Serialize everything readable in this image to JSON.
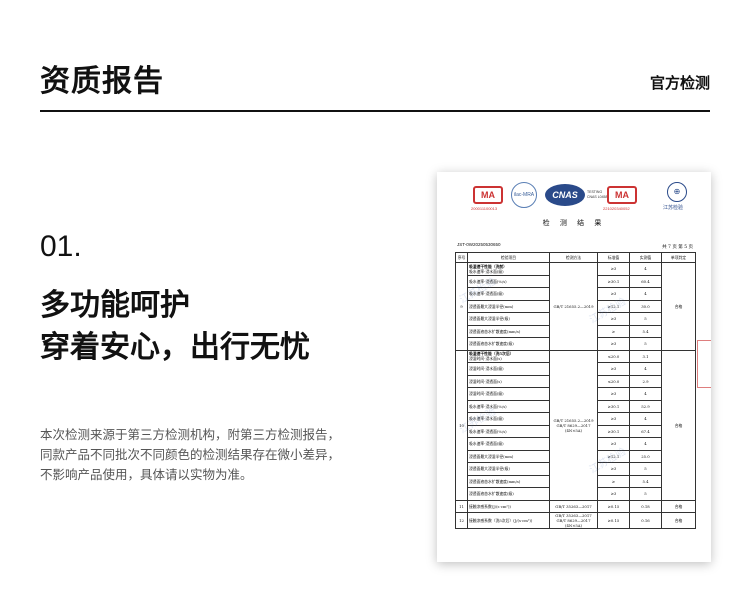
{
  "header": {
    "title": "资质报告",
    "subtitle": "官方检测"
  },
  "feature": {
    "number": "01.",
    "line1": "多功能呵护",
    "line2": "穿着安心，出行无忧"
  },
  "description": [
    "本次检测来源于第三方检测机构，附第三方检测报告，",
    "同款产品不同批次不同颜色的检测结果存在微小差异，",
    "不影响产品使用，具体请以实物为准。"
  ],
  "report": {
    "logos": {
      "ma1": "MA",
      "ma1_no": "200011100013",
      "ilac": "ilac-MRA",
      "cnas": "CNAS",
      "cnas_sub1": "TESTING",
      "cnas_sub2": "CNAS L0458",
      "ma2": "MA",
      "ma2_no": "221020340052",
      "js_label": "江苏检验"
    },
    "title": "检 测 结 果",
    "report_no": "JST-0W20250530650",
    "page": "共 7 页 第 5 页",
    "columns": [
      "序号",
      "检验项目",
      "检测方法",
      "标准值",
      "实测值",
      "单项判定"
    ],
    "group9": {
      "no": "9",
      "item": "吸湿速干性能（洗前）",
      "method": "GB/T 21655.2—2019",
      "verdict": "合格",
      "rows": [
        {
          "item": "吸水速率-浸水面(级)",
          "std": "≥3",
          "val": "4"
        },
        {
          "item": "吸水速率-浸透面(%/s)",
          "std": "≥30.1",
          "val": "60.4"
        },
        {
          "item": "吸水速率-浸透面(级)",
          "std": "≥3",
          "val": "4"
        },
        {
          "item": "浸透面最大浸湿半径(mm)",
          "std": "≥12.1",
          "val": "30.0"
        },
        {
          "item": "浸透面最大浸湿半径(级)",
          "std": "≥3",
          "val": "5"
        },
        {
          "item": "浸透面液态水扩散速度(mm/s)",
          "std": "≥",
          "val": "5.4"
        },
        {
          "item": "浸透面液态水扩散速度(级)",
          "std": "≥3",
          "val": "5"
        }
      ]
    },
    "group10": {
      "no": "10",
      "item": "吸湿速干性能（洗5次后）",
      "method": "GB/T 21655.2—2019 GB/T 8629—2017 (4N×5A)",
      "verdict": "合格",
      "rows": [
        {
          "item": "浸湿时间-浸水面(s)",
          "std": "≤20.0",
          "val": "3.1"
        },
        {
          "item": "浸湿时间-浸水面(级)",
          "std": "≥3",
          "val": "4"
        },
        {
          "item": "浸湿时间-浸透面(s)",
          "std": "≤20.0",
          "val": "2.9"
        },
        {
          "item": "浸湿时间-浸透面(级)",
          "std": "≥3",
          "val": "4"
        },
        {
          "item": "吸水速率-浸水面(%/s)",
          "std": "≥30.1",
          "val": "52.9"
        },
        {
          "item": "吸水速率-浸水面(级)",
          "std": "≥3",
          "val": "4"
        },
        {
          "item": "吸水速率-浸透面(%/s)",
          "std": "≥30.1",
          "val": "67.4"
        },
        {
          "item": "吸水速率-浸透面(级)",
          "std": "≥3",
          "val": "4"
        },
        {
          "item": "浸透面最大浸湿半径(mm)",
          "std": "≥12.1",
          "val": "25.0"
        },
        {
          "item": "浸透面最大浸湿半径(级)",
          "std": "≥3",
          "val": "5"
        },
        {
          "item": "浸透面液态水扩散速度(mm/s)",
          "std": "≥",
          "val": "5.4"
        },
        {
          "item": "浸透面液态水扩散速度(级)",
          "std": "≥3",
          "val": "5"
        }
      ]
    },
    "row11": {
      "no": "11",
      "item": "接触凉感系数(J/(s·cm²))",
      "method": "GB/T 35263—2017",
      "std": "≥0.15",
      "val": "0.18",
      "verdict": "合格"
    },
    "row12": {
      "no": "12",
      "item": "接触凉感系数（洗5次后）(J/(s·cm²))",
      "method": "GB/T 35263—2017 GB/T 8629—2017 (4N×5A)",
      "std": "≥0.15",
      "val": "0.16",
      "verdict": "合格"
    },
    "watermark": "江苏检验"
  }
}
